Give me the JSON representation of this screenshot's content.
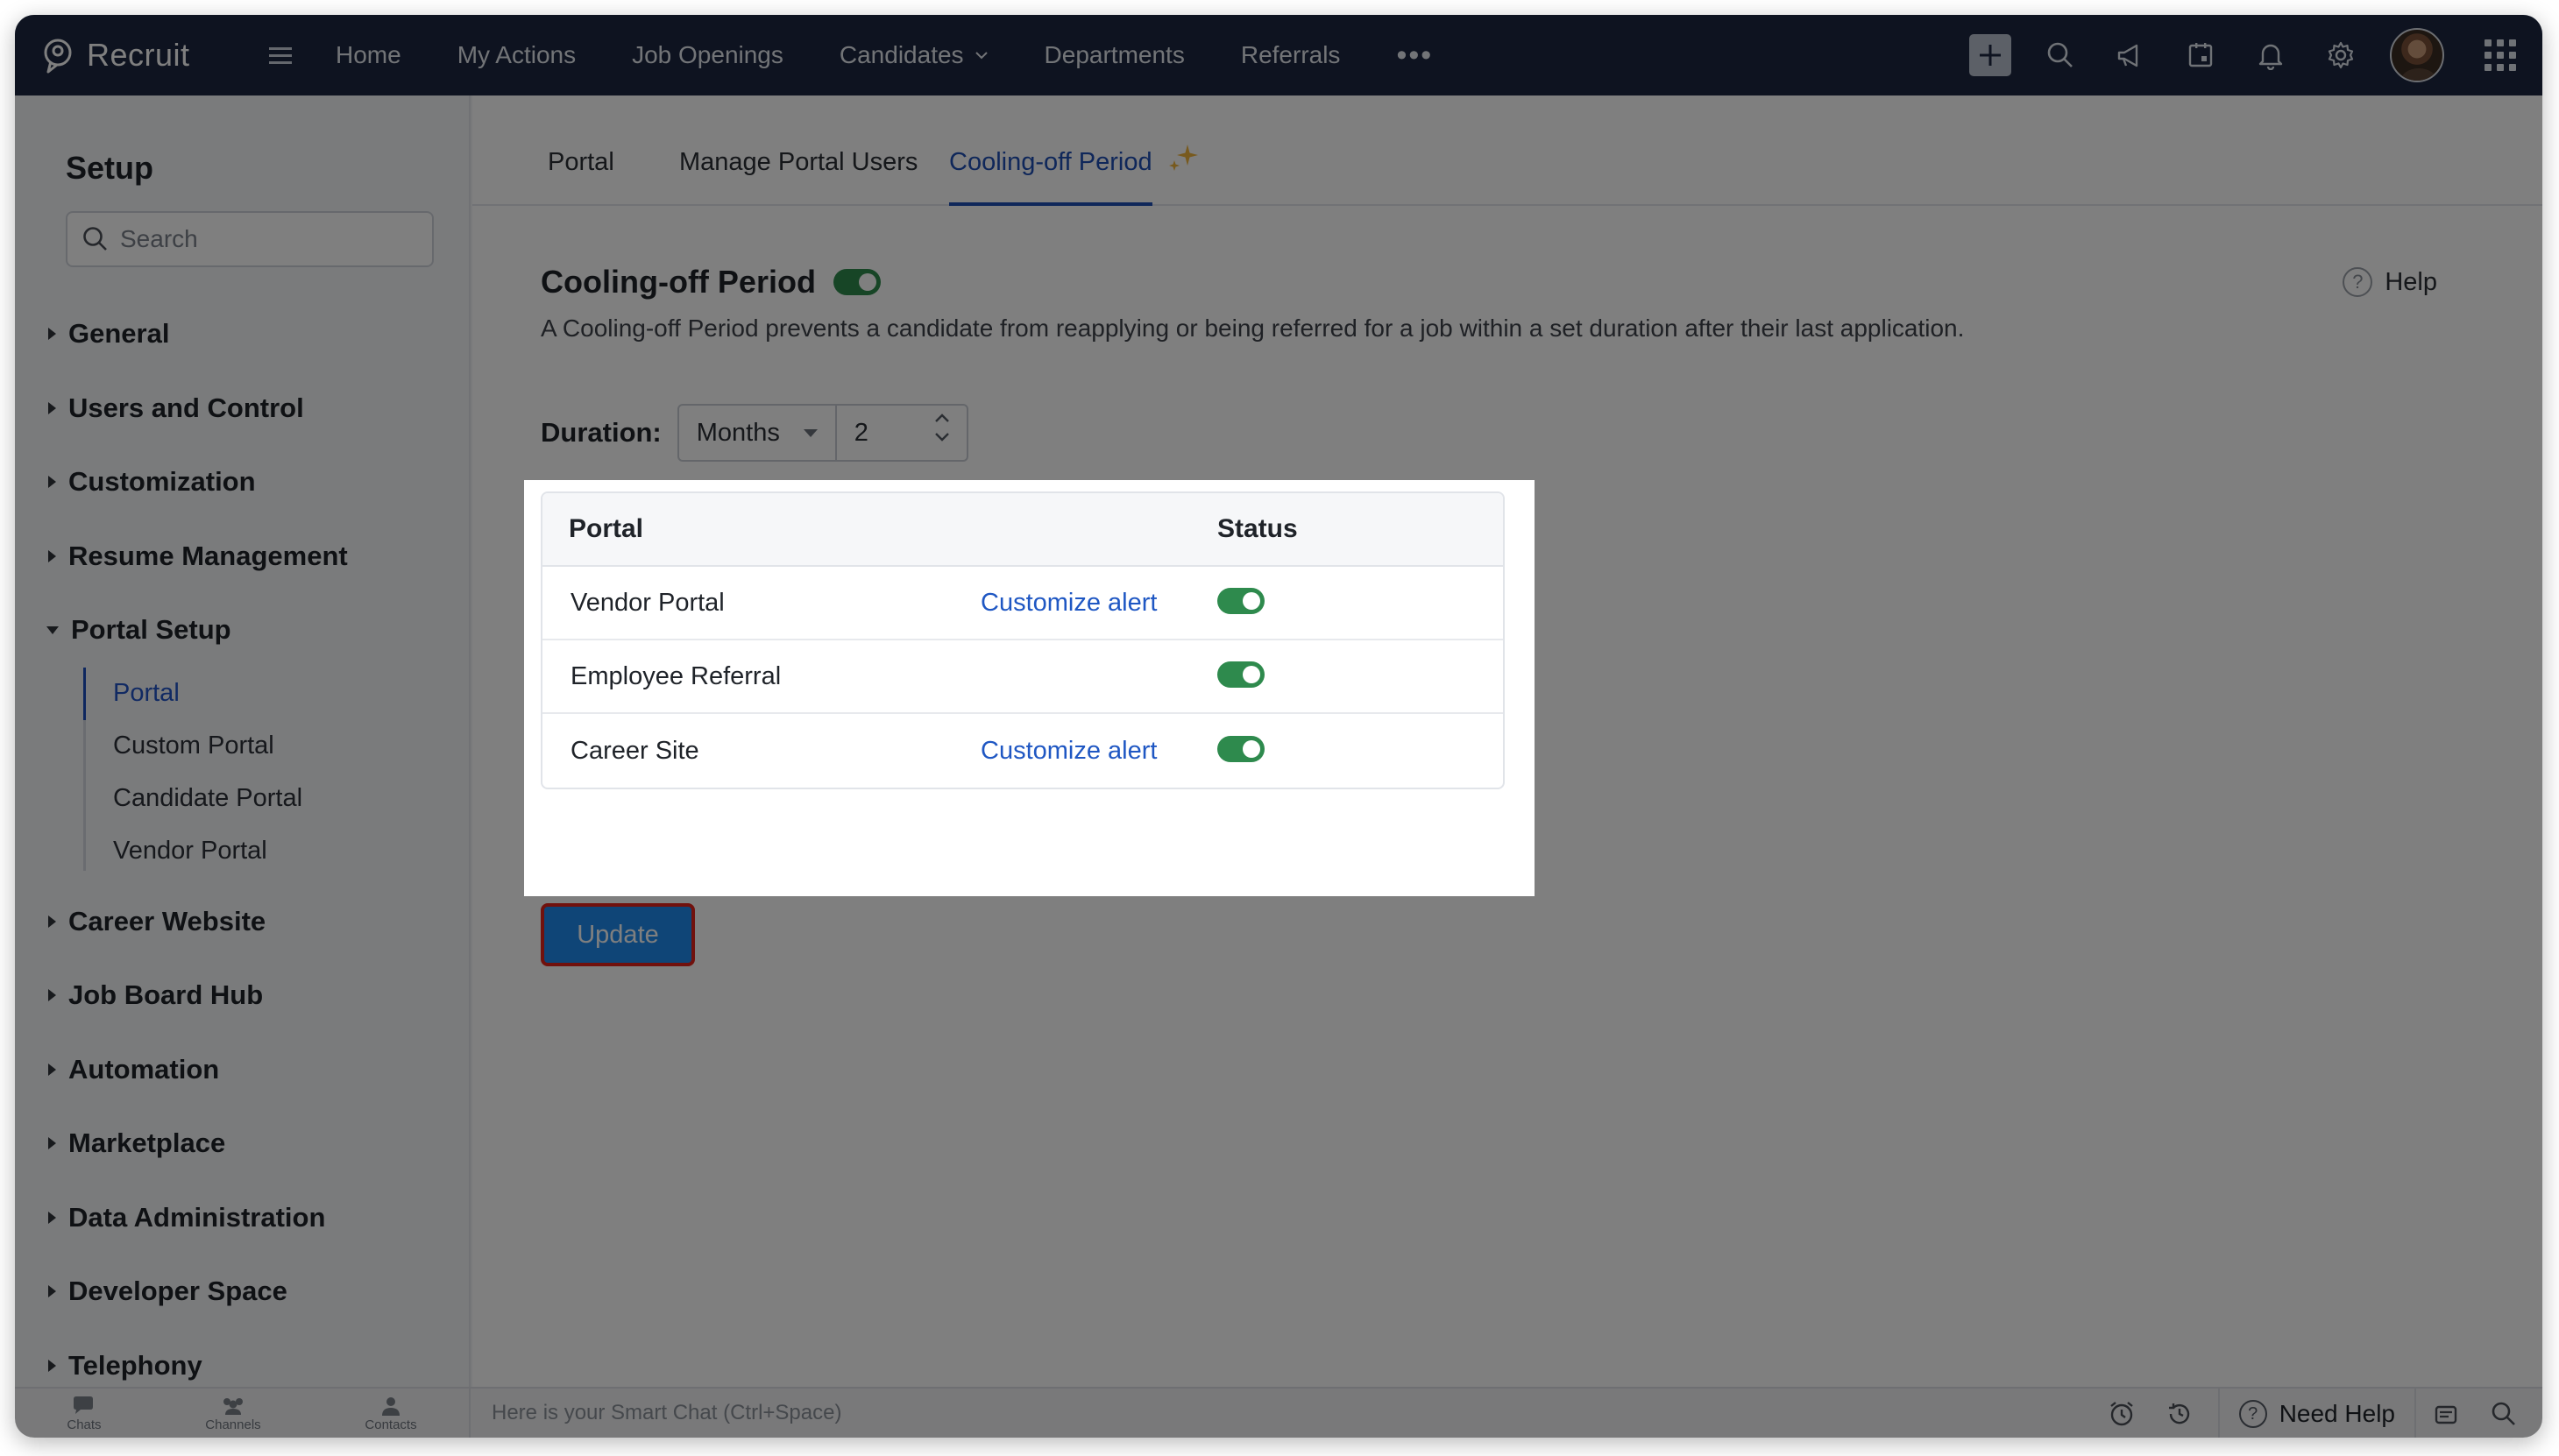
{
  "app": {
    "brand": "Recruit"
  },
  "topnav": {
    "items": [
      "Home",
      "My Actions",
      "Job Openings",
      "Candidates",
      "Departments",
      "Referrals"
    ],
    "more": "•••",
    "icons": [
      "plus-icon",
      "search-icon",
      "megaphone-icon",
      "calendar-icon",
      "bell-icon",
      "gear-icon",
      "avatar",
      "apps-grid-icon"
    ]
  },
  "sidebar": {
    "title": "Setup",
    "search_placeholder": "Search",
    "items": [
      {
        "label": "General"
      },
      {
        "label": "Users and Control"
      },
      {
        "label": "Customization"
      },
      {
        "label": "Resume Management"
      },
      {
        "label": "Portal Setup",
        "open": true,
        "children": [
          "Portal",
          "Custom Portal",
          "Candidate Portal",
          "Vendor Portal"
        ],
        "active_child": "Portal"
      },
      {
        "label": "Career Website"
      },
      {
        "label": "Job Board Hub"
      },
      {
        "label": "Automation"
      },
      {
        "label": "Marketplace"
      },
      {
        "label": "Data Administration"
      },
      {
        "label": "Developer Space"
      },
      {
        "label": "Telephony"
      }
    ]
  },
  "tabs": [
    {
      "label": "Portal",
      "active": false
    },
    {
      "label": "Manage Portal Users",
      "active": false
    },
    {
      "label": "Cooling-off Period",
      "active": true
    }
  ],
  "section": {
    "title": "Cooling-off Period",
    "enabled": true,
    "help": "Help",
    "description": "A Cooling-off Period prevents a candidate from reapplying or being referred for a job within a set duration after their last application."
  },
  "duration": {
    "label": "Duration:",
    "unit": "Months",
    "value": "2"
  },
  "table": {
    "headers": {
      "portal": "Portal",
      "status": "Status"
    },
    "rows": [
      {
        "portal": "Vendor Portal",
        "link": "Customize alert",
        "status": true
      },
      {
        "portal": "Employee Referral",
        "link": "",
        "status": true
      },
      {
        "portal": "Career Site",
        "link": "Customize alert",
        "status": true
      }
    ]
  },
  "update_label": "Update",
  "bottombar": {
    "tools": [
      "Chats",
      "Channels",
      "Contacts"
    ],
    "smart_chat_placeholder": "Here is your Smart Chat (Ctrl+Space)",
    "need_help": "Need Help"
  },
  "colors": {
    "topbar": "#1c2740",
    "accent": "#1f4fb5",
    "toggle_on": "#2e8a4d",
    "update_button": "#1f8bef",
    "highlight_border": "#e2231a"
  }
}
